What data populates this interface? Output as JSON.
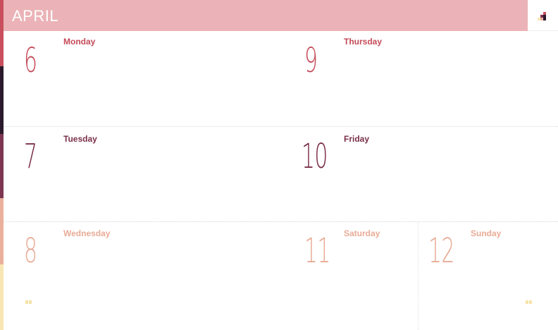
{
  "month": "APRIL",
  "colors": {
    "stripe": [
      "#c94f5e",
      "#2b1a2c",
      "#7d3550",
      "#eab09c",
      "#f8e6b4"
    ],
    "header_bg": "#ebb3b7",
    "week1": "#c44a57",
    "week2": "#7b2f48",
    "weekend": "#e8ab96"
  },
  "days": [
    {
      "number": "6",
      "name": "Monday"
    },
    {
      "number": "7",
      "name": "Tuesday"
    },
    {
      "number": "8",
      "name": "Wednesday"
    },
    {
      "number": "9",
      "name": "Thursday"
    },
    {
      "number": "10",
      "name": "Friday"
    },
    {
      "number": "11",
      "name": "Saturday"
    },
    {
      "number": "12",
      "name": "Sunday"
    }
  ],
  "icons": [
    "app-logo-icon",
    "more-dots-icon"
  ]
}
